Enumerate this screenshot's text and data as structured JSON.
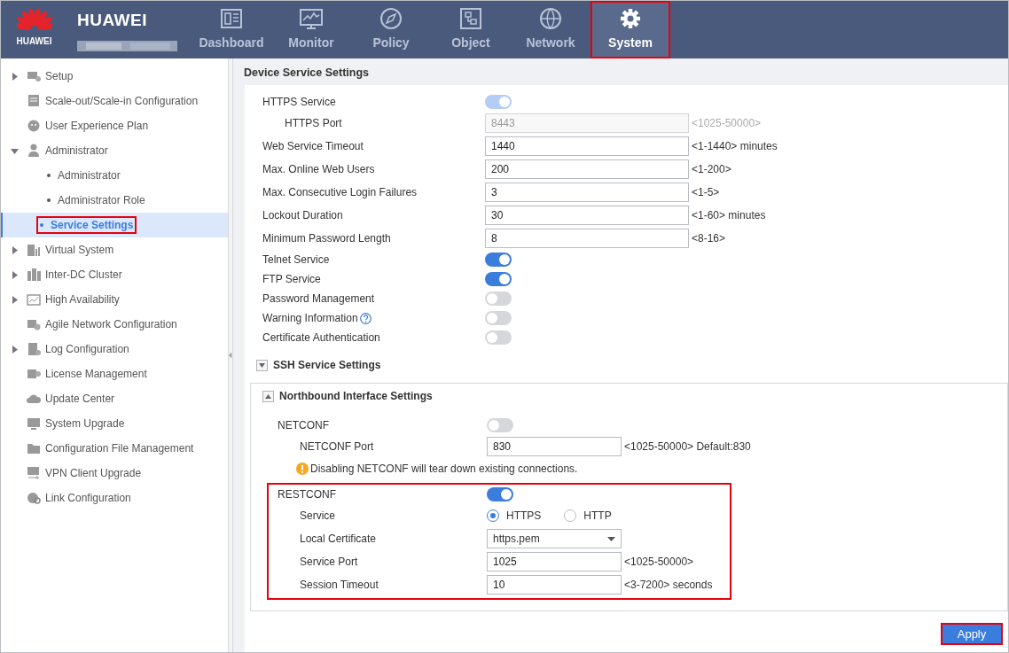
{
  "header": {
    "logo_text": "HUAWEI",
    "brand": "HUAWEI",
    "nav": [
      {
        "label": "Dashboard",
        "selected": false,
        "annotated": false
      },
      {
        "label": "Monitor",
        "selected": false,
        "annotated": false
      },
      {
        "label": "Policy",
        "selected": false,
        "annotated": false
      },
      {
        "label": "Object",
        "selected": false,
        "annotated": false
      },
      {
        "label": "Network",
        "selected": false,
        "annotated": false
      },
      {
        "label": "System",
        "selected": true,
        "annotated": true
      }
    ]
  },
  "sidebar": {
    "items": [
      {
        "kind": "group",
        "label": "Setup",
        "expanded": false
      },
      {
        "kind": "link",
        "label": "Scale-out/Scale-in Configuration"
      },
      {
        "kind": "link",
        "label": "User Experience Plan"
      },
      {
        "kind": "group",
        "label": "Administrator",
        "expanded": true,
        "children": [
          {
            "label": "Administrator",
            "selected": false,
            "annotated": false
          },
          {
            "label": "Administrator Role",
            "selected": false,
            "annotated": false
          },
          {
            "label": "Service Settings",
            "selected": true,
            "annotated": true
          }
        ]
      },
      {
        "kind": "group",
        "label": "Virtual System",
        "expanded": false
      },
      {
        "kind": "group",
        "label": "Inter-DC Cluster",
        "expanded": false
      },
      {
        "kind": "group",
        "label": "High Availability",
        "expanded": false
      },
      {
        "kind": "link",
        "label": "Agile Network Configuration"
      },
      {
        "kind": "group",
        "label": "Log Configuration",
        "expanded": false
      },
      {
        "kind": "link",
        "label": "License Management"
      },
      {
        "kind": "link",
        "label": "Update Center"
      },
      {
        "kind": "link",
        "label": "System Upgrade"
      },
      {
        "kind": "link",
        "label": "Configuration File Management"
      },
      {
        "kind": "link",
        "label": "VPN Client Upgrade"
      },
      {
        "kind": "link",
        "label": "Link Configuration"
      }
    ]
  },
  "page_title": "Device Service Settings",
  "settings": [
    {
      "kind": "toggle",
      "label": "HTTPS Service",
      "on": true,
      "disabled": true,
      "children": [
        {
          "kind": "input",
          "label": "HTTPS Port",
          "value": "8443",
          "hint": "<1025-50000>",
          "disabled": true
        }
      ]
    },
    {
      "kind": "input",
      "label": "Web Service Timeout",
      "value": "1440",
      "hint": "<1-1440> minutes",
      "disabled": false
    },
    {
      "kind": "input",
      "label": "Max. Online Web Users",
      "value": "200",
      "hint": "<1-200>",
      "disabled": false
    },
    {
      "kind": "input",
      "label": "Max. Consecutive Login Failures",
      "value": "3",
      "hint": "<1-5>",
      "disabled": false
    },
    {
      "kind": "input",
      "label": "Lockout Duration",
      "value": "30",
      "hint": "<1-60> minutes",
      "disabled": false
    },
    {
      "kind": "input",
      "label": "Minimum Password Length",
      "value": "8",
      "hint": "<8-16>",
      "disabled": false
    },
    {
      "kind": "toggle",
      "label": "Telnet Service",
      "on": true,
      "disabled": false
    },
    {
      "kind": "toggle",
      "label": "FTP Service",
      "on": true,
      "disabled": false
    },
    {
      "kind": "toggle",
      "label": "Password Management",
      "on": false,
      "disabled": false
    },
    {
      "kind": "toggle",
      "label": "Warning Information",
      "on": false,
      "disabled": false,
      "help": true
    },
    {
      "kind": "toggle",
      "label": "Certificate Authentication",
      "on": false,
      "disabled": false
    }
  ],
  "sections": [
    {
      "title": "SSH Service Settings",
      "expanded": false
    },
    {
      "title": "Northbound Interface Settings",
      "expanded": true,
      "settings": [
        {
          "kind": "toggle",
          "label": "NETCONF",
          "on": false,
          "disabled": false,
          "annotated": false,
          "children": [
            {
              "kind": "input",
              "label": "NETCONF Port",
              "value": "830",
              "hint": "<1025-50000> Default:830",
              "disabled": false
            },
            {
              "kind": "warning",
              "text": "Disabling NETCONF will tear down existing connections."
            }
          ]
        },
        {
          "kind": "toggle",
          "label": "RESTCONF",
          "on": true,
          "disabled": false,
          "annotated": true,
          "children": [
            {
              "kind": "radio",
              "label": "Service",
              "options": [
                {
                  "label": "HTTPS",
                  "selected": true
                },
                {
                  "label": "HTTP",
                  "selected": false
                }
              ]
            },
            {
              "kind": "select",
              "label": "Local Certificate",
              "value": "https.pem"
            },
            {
              "kind": "input",
              "label": "Service Port",
              "value": "1025",
              "hint": "<1025-50000>",
              "disabled": false
            },
            {
              "kind": "input",
              "label": "Session Timeout",
              "value": "10",
              "hint": "<3-7200> seconds",
              "disabled": false
            }
          ]
        }
      ]
    }
  ],
  "apply": {
    "label": "Apply",
    "annotated": true
  }
}
